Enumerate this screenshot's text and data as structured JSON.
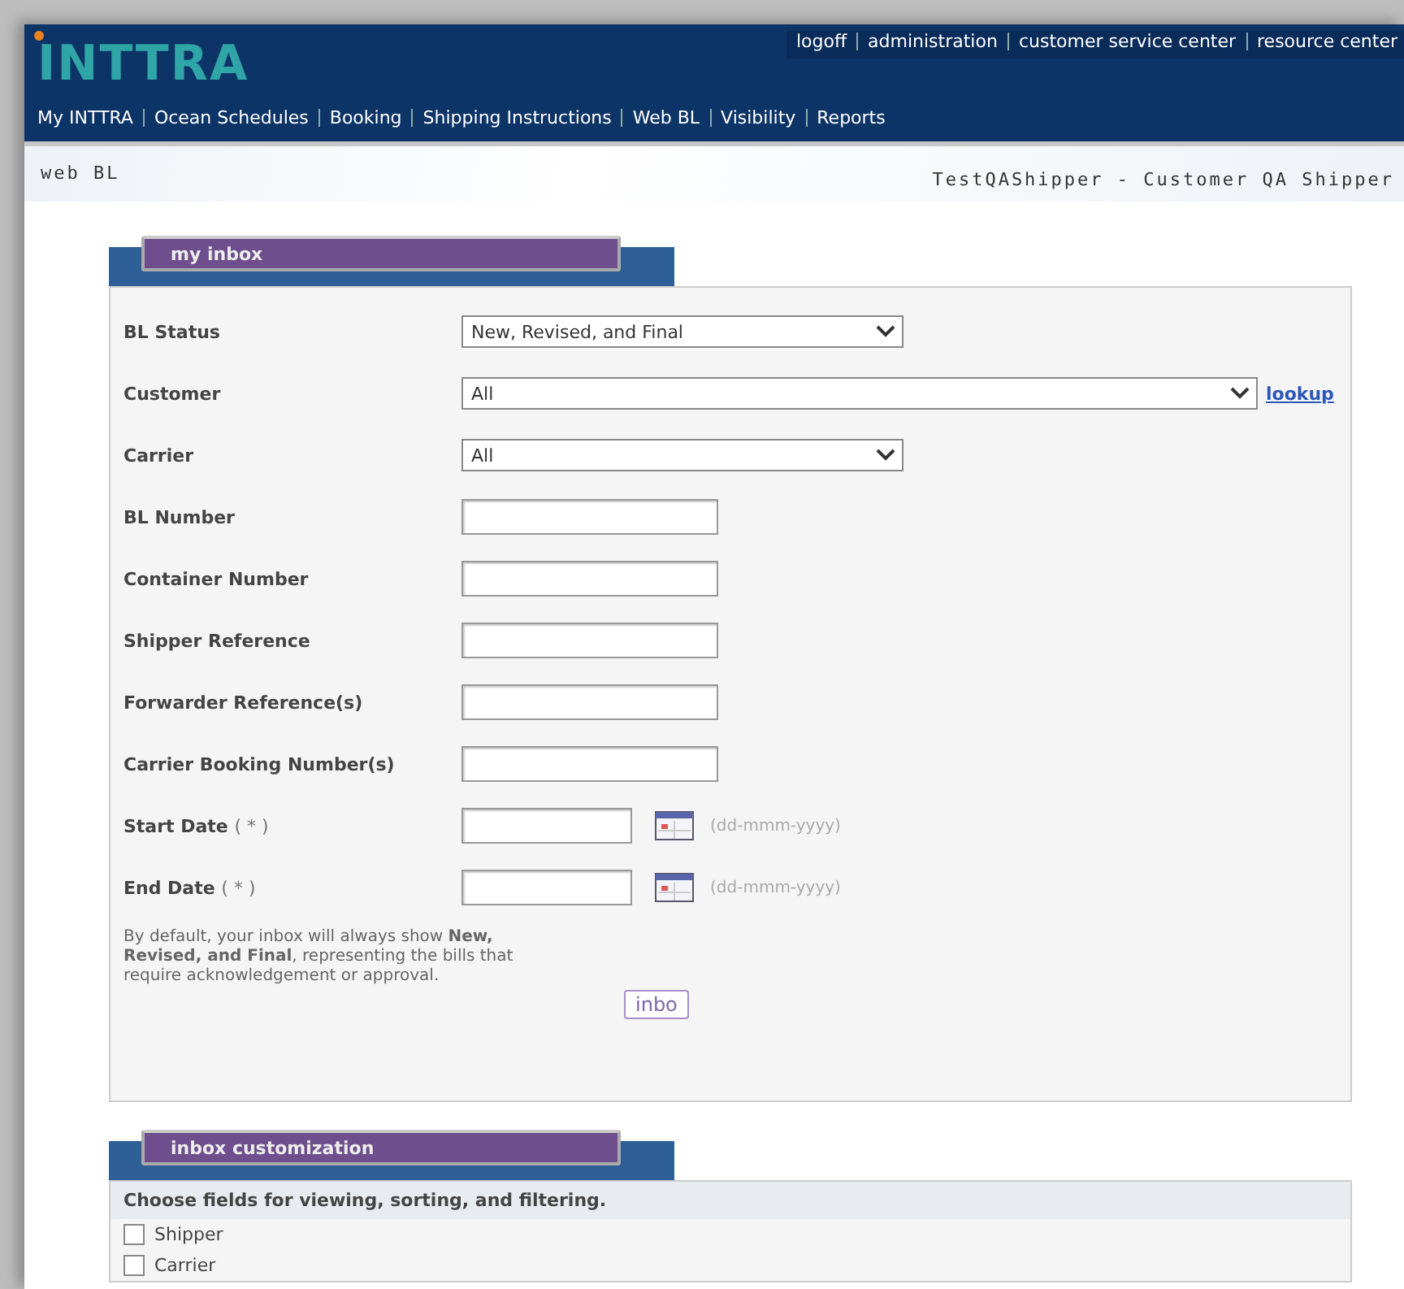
{
  "logo": "INTTRA",
  "top_links": [
    "logoff",
    "administration",
    "customer service center",
    "resource center"
  ],
  "nav": [
    "My INTTRA",
    "Ocean Schedules",
    "Booking",
    "Shipping Instructions",
    "Web BL",
    "Visibility",
    "Reports"
  ],
  "page": {
    "title": "web BL",
    "account": "TestQAShipper - Customer QA Shipper"
  },
  "inbox": {
    "title": "my inbox",
    "fields": [
      {
        "kind": "select",
        "label": "BL Status",
        "value": "New, Revised, and Final"
      },
      {
        "kind": "select-lookup",
        "label": "Customer",
        "value": "All",
        "link": "lookup"
      },
      {
        "kind": "select",
        "label": "Carrier",
        "value": "All"
      },
      {
        "kind": "text",
        "label": "BL Number"
      },
      {
        "kind": "text",
        "label": "Container Number"
      },
      {
        "kind": "text",
        "label": "Shipper Reference"
      },
      {
        "kind": "text",
        "label": "Forwarder Reference(s)"
      },
      {
        "kind": "text",
        "label": "Carrier Booking Number(s)"
      },
      {
        "kind": "date",
        "label": "Start Date",
        "note": "( * )",
        "hint": "(dd-mmm-yyyy)"
      },
      {
        "kind": "date",
        "label": "End Date",
        "note": "( * )",
        "hint": "(dd-mmm-yyyy)"
      }
    ],
    "info": "By default, your inbox will always show **New, Revised, and Final**, representing the bills that require acknowledgement or approval.",
    "button": "inbo"
  },
  "customization": {
    "title": "inbox customization",
    "intro": "Choose fields for viewing, sorting, and filtering.",
    "options": [
      {
        "label": "Shipper",
        "checked": false
      },
      {
        "label": "Carrier",
        "checked": false
      }
    ]
  }
}
